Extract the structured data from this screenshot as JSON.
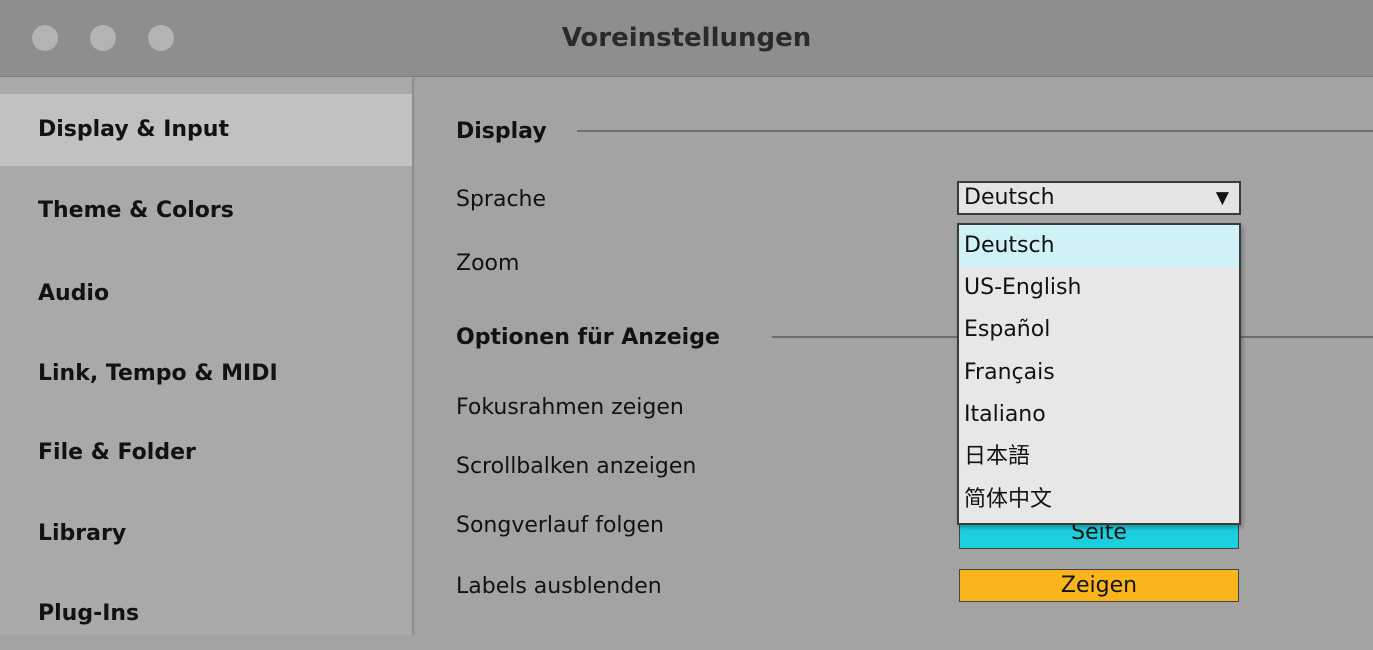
{
  "window": {
    "title": "Voreinstellungen"
  },
  "sidebar": {
    "items": [
      {
        "label": "Display & Input",
        "active": true
      },
      {
        "label": "Theme & Colors"
      },
      {
        "label": "Audio"
      },
      {
        "label": "Link, Tempo & MIDI"
      },
      {
        "label": "File & Folder"
      },
      {
        "label": "Library"
      },
      {
        "label": "Plug-Ins"
      }
    ]
  },
  "display_section": {
    "heading": "Display",
    "language_label": "Sprache",
    "language_value": "Deutsch",
    "zoom_label": "Zoom"
  },
  "language_dropdown": {
    "options": [
      "Deutsch",
      "US-English",
      "Español",
      "Français",
      "Italiano",
      "日本語",
      "简体中文"
    ],
    "highlighted": "Deutsch"
  },
  "options_section": {
    "heading": "Optionen für Anzeige",
    "focus_frame_label": "Fokusrahmen zeigen",
    "scrollbar_label": "Scrollbalken anzeigen",
    "follow_label": "Songverlauf folgen",
    "follow_value": "Seite",
    "hide_labels_label": "Labels ausblenden",
    "hide_labels_value": "Zeigen"
  },
  "colors": {
    "follow_button": "#1ccfdf",
    "hide_labels_button": "#fbb51c",
    "highlight": "#cff2f7"
  }
}
